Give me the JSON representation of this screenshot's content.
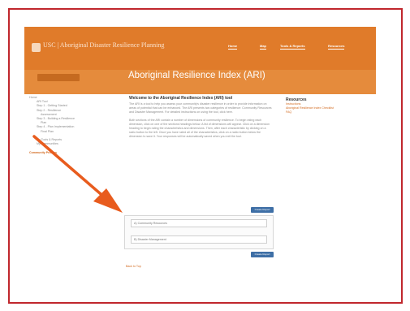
{
  "site": {
    "logo_text": "USC | Aboriginal Disaster Resilience Planning",
    "nav": [
      "Home",
      "Map",
      "Tools & Reports",
      "Resources"
    ]
  },
  "banner": {
    "title": "Aboriginal Resilience Index (ARI)"
  },
  "sidebar": {
    "items": [
      {
        "label": "Home",
        "style": "top"
      },
      {
        "label": "ARI Tool",
        "style": "ind"
      },
      {
        "label": "Step 1 - Getting Started",
        "style": "ind"
      },
      {
        "label": "Step 2 - Resilience",
        "style": "ind"
      },
      {
        "label": "Assessment",
        "style": "ind2"
      },
      {
        "label": "Step 3 - Building a Resilience",
        "style": "ind"
      },
      {
        "label": "Plan",
        "style": "ind2"
      },
      {
        "label": "Step 4 - Plan Implementation",
        "style": "ind"
      },
      {
        "label": "Final Plan",
        "style": "ind2"
      },
      {
        "label": "",
        "style": "ind"
      },
      {
        "label": "My Tools & Reports",
        "style": "ind"
      },
      {
        "label": "My Communities",
        "style": "ind"
      },
      {
        "label": "",
        "style": "ind"
      },
      {
        "label": "Community Profiles",
        "style": "hl"
      }
    ]
  },
  "main": {
    "heading": "Welcome to the Aboriginal Resilience Index (ARI) tool",
    "paragraph1": "The ARI is a tool to help you assess your community's disaster resilience in order to provide information on areas of potential that can be enhanced. The ARI presents two categories of resilience: Community Resources and Disaster Management. For detailed instructions on using the tool, click here.",
    "paragraph2": "Both sections of the ARI contain a number of dimensions of community resilience. To begin rating each dimension, click on one of the sections headings below. A list of dimensions will appear. Click on a dimension heading to begin rating the characteristics and dimensions. Then, after each characteristic by clicking on a radio button to the left. Once you have rated all of the characteristics, click on a radio button below the dimension to save it. Your responses will be automatically saved when you exit the tool.",
    "button_top": "Create Report",
    "field1": "A) Community Resources",
    "field2": "B) Disaster Management",
    "button_bottom": "Create Report",
    "back_link": "Back to Top"
  },
  "resources": {
    "heading": "Resources",
    "links": [
      "Instructions",
      "Aboriginal Resilience Index Checklist",
      "FAQ"
    ]
  },
  "colors": {
    "frame": "#c0272d",
    "header": "#e07b2a",
    "banner": "#e58b3c",
    "arrow": "#e85c1e",
    "button": "#3e6fa6",
    "link": "#d2691e"
  }
}
